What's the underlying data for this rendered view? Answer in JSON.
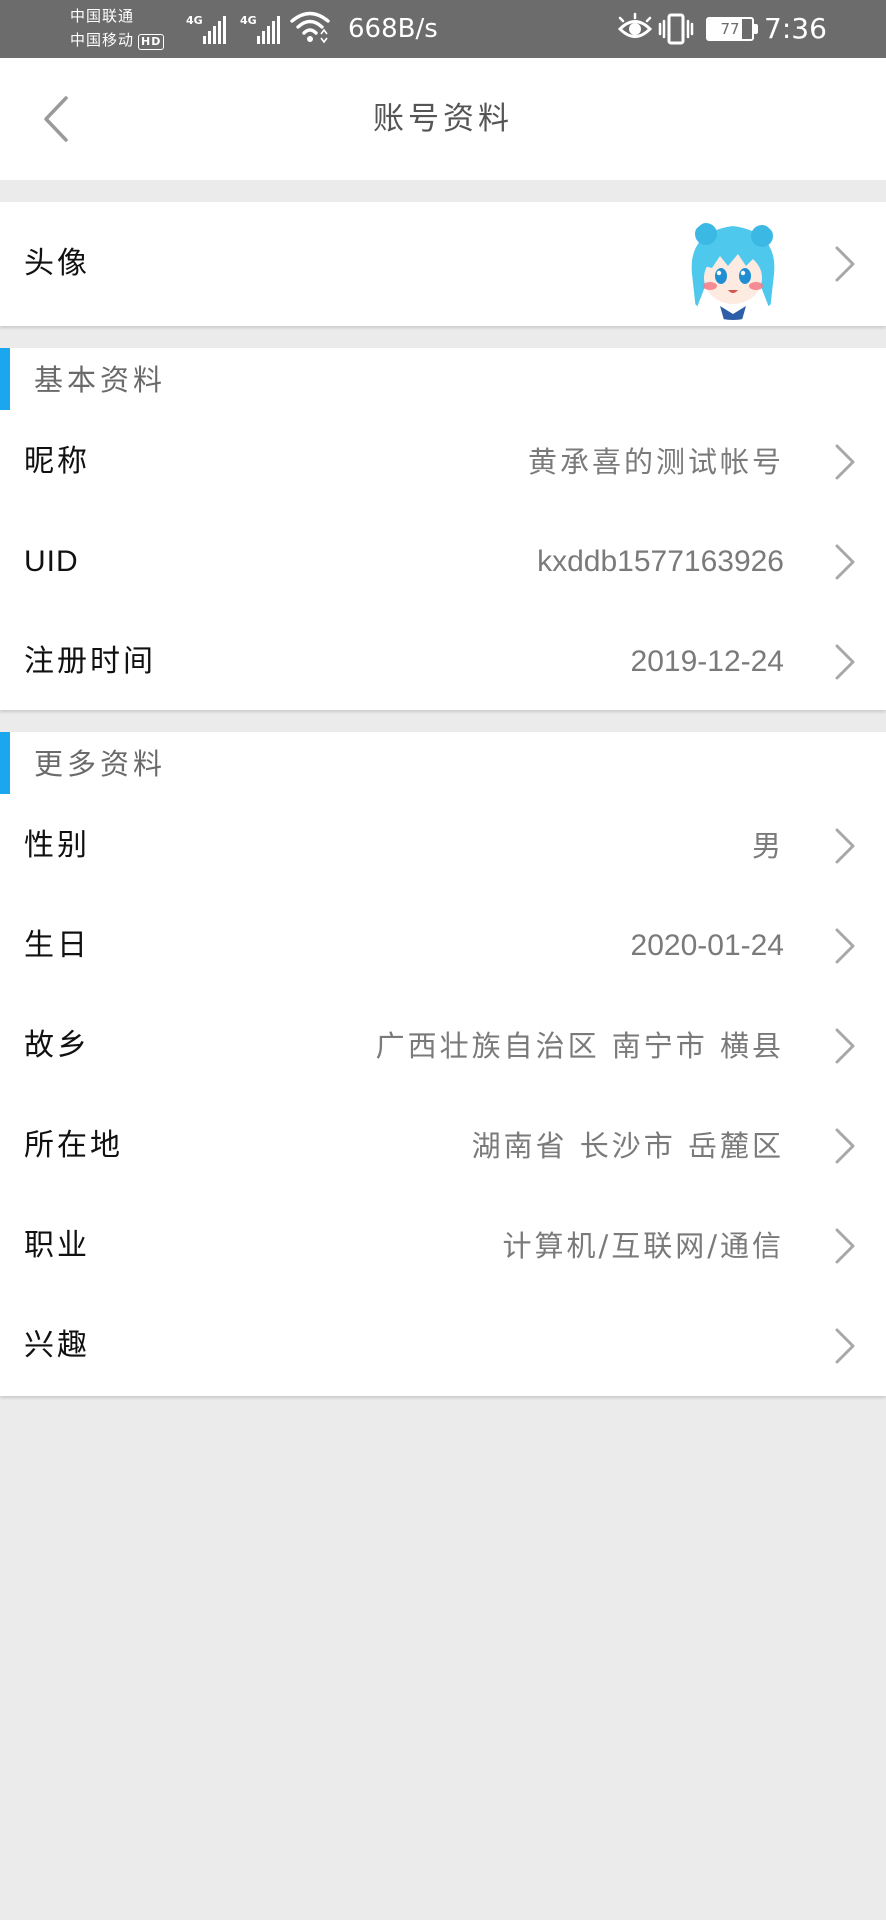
{
  "status_bar": {
    "carrier_1": "中国联通",
    "carrier_2": "中国移动",
    "hd_badge": "HD",
    "network_1": "4G",
    "network_2": "4G",
    "net_speed": "668B/s",
    "battery_level": "77",
    "time": "7:36"
  },
  "header": {
    "title": "账号资料"
  },
  "avatar_row": {
    "label": "头像"
  },
  "basic_section": {
    "title": "基本资料",
    "rows": [
      {
        "label": "昵称",
        "value": "黄承喜的测试帐号"
      },
      {
        "label": "UID",
        "value": "kxddb1577163926"
      },
      {
        "label": "注册时间",
        "value": "2019-12-24"
      }
    ]
  },
  "more_section": {
    "title": "更多资料",
    "rows": [
      {
        "label": "性别",
        "value": "男"
      },
      {
        "label": "生日",
        "value": "2020-01-24"
      },
      {
        "label": "故乡",
        "value": "广西壮族自治区 南宁市 横县"
      },
      {
        "label": "所在地",
        "value": "湖南省 长沙市 岳麓区"
      },
      {
        "label": "职业",
        "value": "计算机/互联网/通信"
      },
      {
        "label": "兴趣",
        "value": ""
      }
    ]
  },
  "colors": {
    "accent": "#1aa7f0",
    "status_bar": "#6c6c6c",
    "page_bg": "#ebebeb"
  },
  "icons": [
    "back-arrow-icon",
    "chevron-right-icon",
    "wifi-icon",
    "eye-icon",
    "vibrate-icon",
    "battery-icon",
    "signal-icon"
  ]
}
